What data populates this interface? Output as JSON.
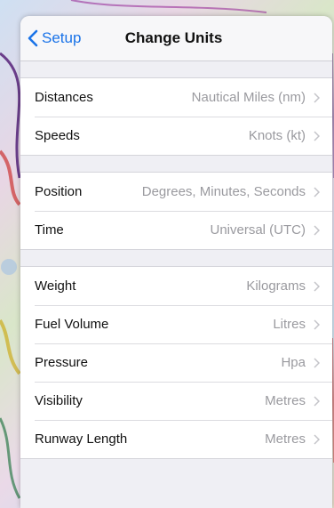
{
  "nav": {
    "back_label": "Setup",
    "title": "Change Units"
  },
  "groups": [
    [
      {
        "label": "Distances",
        "value": "Nautical Miles (nm)"
      },
      {
        "label": "Speeds",
        "value": "Knots (kt)"
      }
    ],
    [
      {
        "label": "Position",
        "value": "Degrees, Minutes, Seconds"
      },
      {
        "label": "Time",
        "value": "Universal (UTC)"
      }
    ],
    [
      {
        "label": "Weight",
        "value": "Kilograms"
      },
      {
        "label": "Fuel Volume",
        "value": "Litres"
      },
      {
        "label": "Pressure",
        "value": "Hpa"
      },
      {
        "label": "Visibility",
        "value": "Metres"
      },
      {
        "label": "Runway Length",
        "value": "Metres"
      }
    ]
  ],
  "colors": {
    "accent": "#1a73e8",
    "secondary_text": "#9a9a9f",
    "background": "#efeff4"
  }
}
